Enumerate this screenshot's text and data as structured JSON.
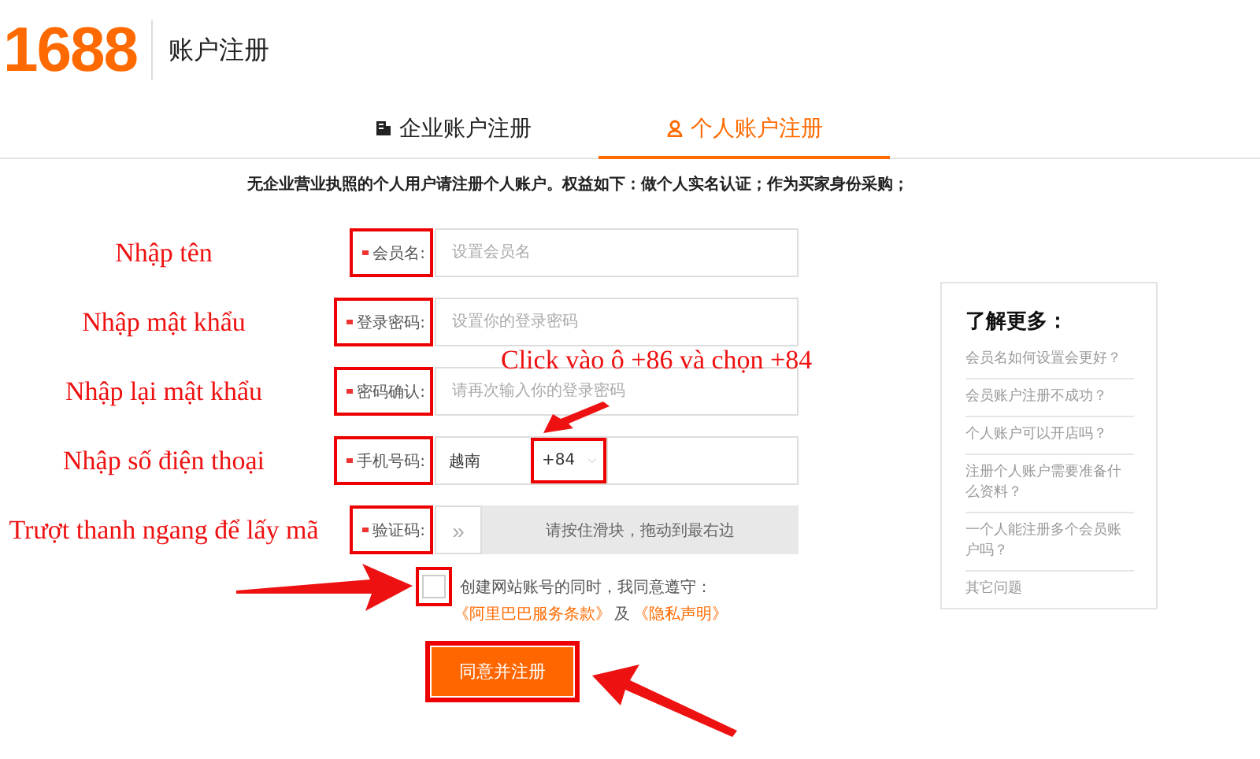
{
  "header": {
    "logo": "1688",
    "title": "账户注册"
  },
  "tabs": [
    {
      "label": "企业账户注册",
      "selected": false
    },
    {
      "label": "个人账户注册",
      "selected": true
    }
  ],
  "notice": "无企业营业执照的个人用户请注册个人账户。权益如下：做个人实名认证；作为买家身份采购；",
  "form": {
    "rows": [
      {
        "kind": "text",
        "annotation": "Nhập tên",
        "label": "会员名:",
        "required": true,
        "highlighted": true,
        "placeholder": "设置会员名"
      },
      {
        "kind": "text",
        "annotation": "Nhập mật khẩu",
        "label": "登录密码:",
        "required": true,
        "highlighted": true,
        "placeholder": "设置你的登录密码"
      },
      {
        "kind": "text",
        "annotation": "Nhập lại mật khẩu",
        "label": "密码确认:",
        "required": true,
        "highlighted": true,
        "placeholder": "请再次输入你的登录密码"
      },
      {
        "kind": "phone",
        "annotation": "Nhập số điện thoại",
        "label": "手机号码:",
        "required": true,
        "highlighted": true,
        "country": "越南",
        "code": "+84",
        "code_highlighted": true
      },
      {
        "kind": "slider",
        "annotation": "Trượt thanh ngang để lấy mã",
        "label": "验证码:",
        "required": true,
        "highlighted": true,
        "handle": "»",
        "hint": "请按住滑块，拖动到最右边"
      }
    ],
    "callout": "Click vào ô +86 và chọn +84",
    "agreement": {
      "checked": false,
      "highlighted": true,
      "text": "创建网站账号的同时，我同意遵守：",
      "links": [
        "《阿里巴巴服务条款》",
        "《隐私声明》"
      ],
      "joiner": "及"
    },
    "submit": {
      "label": "同意并注册",
      "highlighted": true
    }
  },
  "sidebar": {
    "title": "了解更多：",
    "items": [
      "会员名如何设置会更好？",
      "会员账户注册不成功？",
      "个人账户可以开店吗？",
      "注册个人账户需要准备什么资料？",
      "一个人能注册多个会员账户吗？",
      "其它问题"
    ]
  }
}
